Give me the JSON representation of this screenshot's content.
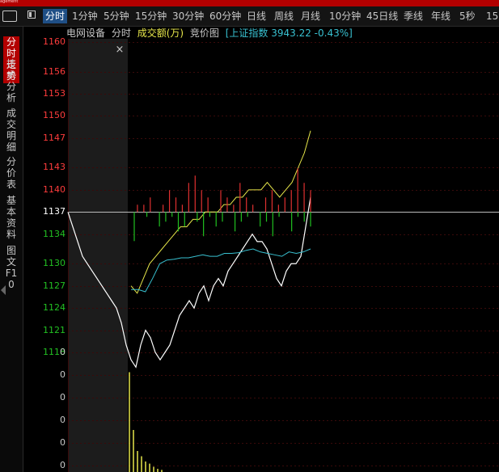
{
  "app": {
    "brand": "agement"
  },
  "tabs": [
    {
      "label": "分时",
      "active": true
    },
    {
      "label": "1分钟"
    },
    {
      "label": "5分钟"
    },
    {
      "label": "15分钟"
    },
    {
      "label": "30分钟"
    },
    {
      "label": "60分钟"
    },
    {
      "label": "日线"
    },
    {
      "label": "周线"
    },
    {
      "label": "月线"
    },
    {
      "label": "10分钟"
    },
    {
      "label": "45日线"
    },
    {
      "label": "季线"
    },
    {
      "label": "年线"
    },
    {
      "label": "5秒"
    },
    {
      "label": "15"
    }
  ],
  "sidebar": [
    {
      "label": "分时走势",
      "active": true
    },
    {
      "label": "技术分析"
    },
    {
      "label": "成交明细"
    },
    {
      "label": "分价表"
    },
    {
      "label": "基本资料"
    },
    {
      "label": "图文F10"
    }
  ],
  "info": {
    "stock": "电网设备",
    "mode": "分时",
    "volume_label": "成交额(万)",
    "auction": "竞价图",
    "index": "[上证指数 3943.22 -0.43%]"
  },
  "close_glyph": "×",
  "colors": {
    "up": "#ff3c3c",
    "down": "#22c122",
    "neutral": "#ffffff",
    "price_line": "#ffffff",
    "avg_line": "#e6e64a",
    "index_line": "#38c0d0",
    "bar_up": "#e03030",
    "bar_down": "#20c020",
    "auction_bg": "#1c1c1c"
  },
  "chart_data": {
    "type": "line",
    "price_axis": {
      "ticks": [
        1160,
        1156,
        1153,
        1150,
        1147,
        1143,
        1140,
        1137,
        1134,
        1130,
        1127,
        1124,
        1121,
        1118
      ],
      "prev_close": 1137
    },
    "volume_axis": {
      "ticks": [
        0,
        0,
        0,
        0,
        0,
        0
      ]
    },
    "series": [
      {
        "values": [
          1137,
          1135,
          1133,
          1131,
          1130,
          1129,
          1128,
          1127,
          1126,
          1125,
          1124,
          1122,
          1119,
          1117,
          1116,
          1119,
          1121,
          1120,
          1118,
          1117,
          1118,
          1119,
          1121,
          1123,
          1124,
          1125,
          1124,
          1126,
          1127,
          1125,
          1127,
          1128,
          1127,
          1129,
          1130,
          1131,
          1132,
          1133,
          1134,
          1133,
          1133,
          1132,
          1130,
          1128,
          1127,
          1129,
          1130,
          1130,
          1131,
          1135,
          1139
        ]
      },
      {
        "values": [
          1127,
          1126,
          1128,
          1130,
          1131,
          1132,
          1133,
          1134,
          1135,
          1135,
          1136,
          1136,
          1137,
          1137,
          1137,
          1138,
          1138,
          1139,
          1139,
          1140,
          1140,
          1140,
          1141,
          1140,
          1139,
          1140,
          1141,
          1143,
          1145,
          1148
        ]
      },
      {
        "values": [
          1126.5,
          1126.5,
          1126.2,
          1128,
          1130,
          1130.5,
          1130.6,
          1130.8,
          1130.8,
          1131,
          1131.2,
          1131,
          1131,
          1131.4,
          1131.4,
          1131.5,
          1131.8,
          1132,
          1131.6,
          1131.4,
          1131.2,
          1131,
          1131.6,
          1131.4,
          1131.6,
          1132
        ]
      }
    ],
    "volume_bars": {
      "up": [
        0,
        1,
        1,
        2,
        0,
        1,
        3,
        2,
        1,
        4,
        5,
        3,
        2,
        0,
        3,
        2,
        1,
        4,
        2,
        1,
        0,
        2,
        3,
        1,
        2,
        3,
        6,
        4,
        3
      ],
      "down": [
        6,
        0,
        1,
        0,
        3,
        2,
        1,
        4,
        3,
        0,
        2,
        5,
        1,
        3,
        2,
        0,
        4,
        2,
        1,
        0,
        3,
        2,
        5,
        1,
        0,
        4,
        1,
        2,
        3
      ]
    },
    "auction_volume": [
      95,
      40,
      20,
      15,
      10,
      8,
      5,
      3,
      2
    ]
  }
}
